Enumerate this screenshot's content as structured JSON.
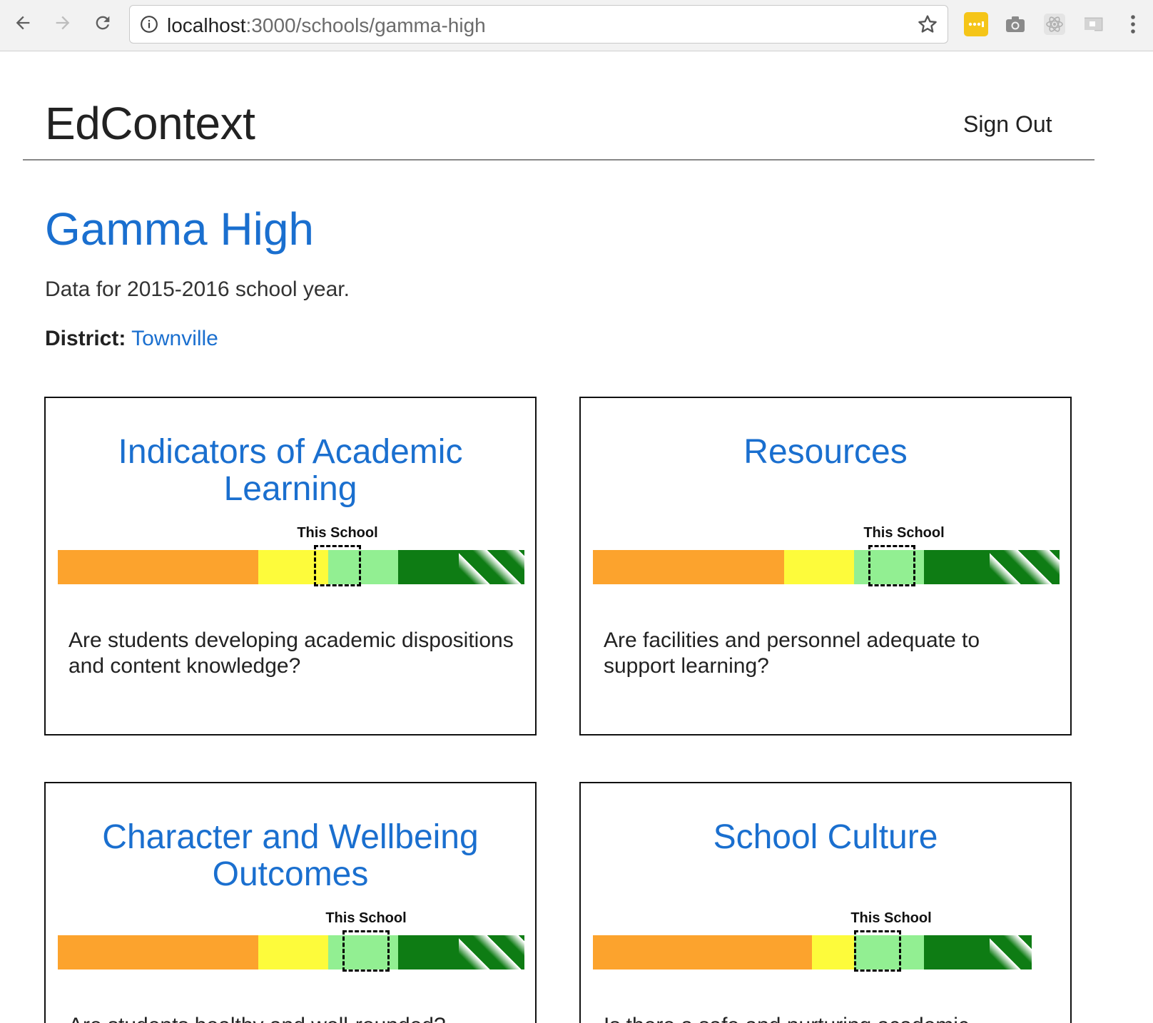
{
  "browser": {
    "url_host": "localhost",
    "url_rest": ":3000/schools/gamma-high",
    "icons": [
      "back-icon",
      "forward-icon",
      "reload-icon",
      "info-icon",
      "star-icon",
      "extension-icons",
      "menu-icon"
    ],
    "extension_colors": [
      "#f5c518",
      "#8a8a8a",
      "#b0b0b0",
      "#c0c0c0"
    ]
  },
  "header": {
    "brand": "EdContext",
    "sign_out": "Sign Out"
  },
  "school": {
    "name": "Gamma High",
    "data_year": "Data for 2015-2016 school year.",
    "district_label": "District:",
    "district_name": "Townville"
  },
  "colors": {
    "link": "#1a6fcf",
    "orange": "#fca32d",
    "yellow": "#fdfb3b",
    "light_green": "#92ef92",
    "dark_green": "#0e7c14"
  },
  "cards": [
    {
      "title": "Indicators of Academic Learning",
      "marker_label": "This School",
      "question": "Are students developing academic dispositions and content knowledge?",
      "bands": [
        0.43,
        0.15,
        0.15,
        0.13,
        0.14
      ],
      "marker_position": 0.6
    },
    {
      "title": "Resources",
      "marker_label": "This School",
      "question": "Are facilities and personnel adequate to support learning?",
      "bands": [
        0.41,
        0.15,
        0.15,
        0.14,
        0.15
      ],
      "marker_position": 0.64
    },
    {
      "title": "Character and Wellbeing Outcomes",
      "marker_label": "This School",
      "question": "Are students healthy and well-rounded?",
      "bands": [
        0.43,
        0.15,
        0.15,
        0.13,
        0.14
      ],
      "marker_position": 0.66
    },
    {
      "title": "School Culture",
      "marker_label": "This School",
      "question": "Is there a safe and nurturing academic",
      "bands": [
        0.47,
        0.09,
        0.15,
        0.14,
        0.09
      ],
      "marker_position": 0.61
    }
  ]
}
